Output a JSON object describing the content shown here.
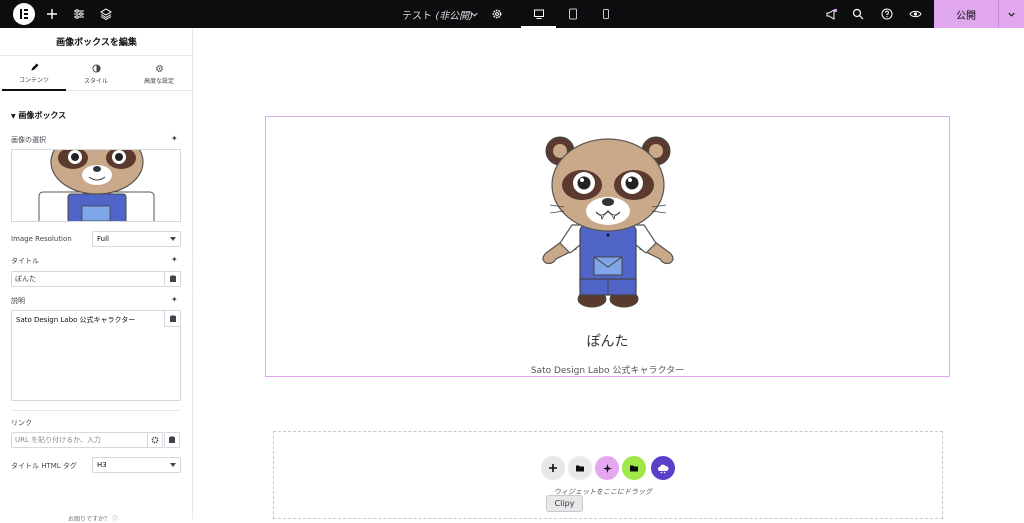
{
  "topbar": {
    "page_title": "テスト",
    "page_status": "(非公開)",
    "publish_label": "公開",
    "icons": [
      "elementor-logo-icon",
      "add-icon",
      "sliders-icon",
      "layers-icon",
      "chevron-down-icon",
      "gear-icon",
      "desktop-icon",
      "tablet-icon",
      "mobile-icon",
      "megaphone-icon",
      "search-icon",
      "help-icon",
      "eye-icon"
    ]
  },
  "panel": {
    "title": "画像ボックスを編集",
    "tabs": [
      {
        "label": "コンテンツ",
        "icon": "pencil-icon",
        "active": true
      },
      {
        "label": "スタイル",
        "icon": "contrast-icon",
        "active": false
      },
      {
        "label": "高度な設定",
        "icon": "gear-icon",
        "active": false
      }
    ],
    "section_title": "画像ボックス",
    "image_label": "画像の選択",
    "resolution_label": "Image Resolution",
    "resolution_value": "Full",
    "title_label": "タイトル",
    "title_value": "ぽんた",
    "description_label": "説明",
    "description_value": "Sato Design Labo 公式キャラクター",
    "link_label": "リンク",
    "link_placeholder": "URL を貼り付けるか、入力",
    "html_tag_label": "タイトル HTML タグ",
    "html_tag_value": "H3",
    "help_text": "お困りですか？"
  },
  "canvas": {
    "widget_title": "ぽんた",
    "widget_description": "Sato Design Labo 公式キャラクター",
    "dropzone_text": "ウィジェットをここにドラッグ",
    "tooltip": "Clipy"
  },
  "colors": {
    "topbar_bg": "#0c0d0e",
    "accent_pink": "#e0a6ee",
    "ai_purple": "#e5a8f0",
    "green": "#9ee84a",
    "navy": "#5b3fc8",
    "overalls_blue": "#5065c7",
    "bear_tan": "#c9a98a"
  }
}
